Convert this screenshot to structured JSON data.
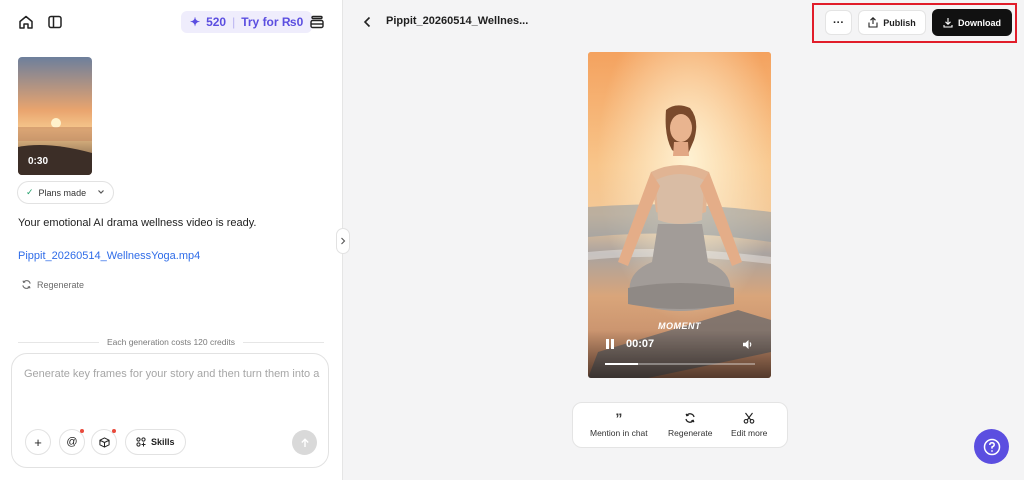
{
  "sidebar": {
    "credits": "520",
    "try_label": "Try for ₨0",
    "thumbnail_duration": "0:30",
    "plans_label": "Plans made",
    "message": "Your emotional AI drama wellness video is ready.",
    "file_link": "Pippit_20260514_WellnessYoga.mp4",
    "regenerate_label": "Regenerate",
    "cost_note": "Each generation costs 120 credits",
    "composer": {
      "placeholder": "Generate key frames for your story and then turn them into a",
      "plus_label": "+",
      "mention_label": "@",
      "skills_label": "Skills"
    }
  },
  "header": {
    "title": "Pippit_20260514_Wellnes...",
    "more_label": "···",
    "publish_label": "Publish",
    "download_label": "Download"
  },
  "video": {
    "caption": "MOMENT",
    "current_time": "00:07",
    "progress_fraction": 0.22
  },
  "actions": {
    "mention_label": "Mention in chat",
    "regenerate_label": "Regenerate",
    "edit_label": "Edit more"
  },
  "colors": {
    "accent": "#5b4ee0",
    "link": "#2f6ce8",
    "highlight": "#e11d2a"
  }
}
